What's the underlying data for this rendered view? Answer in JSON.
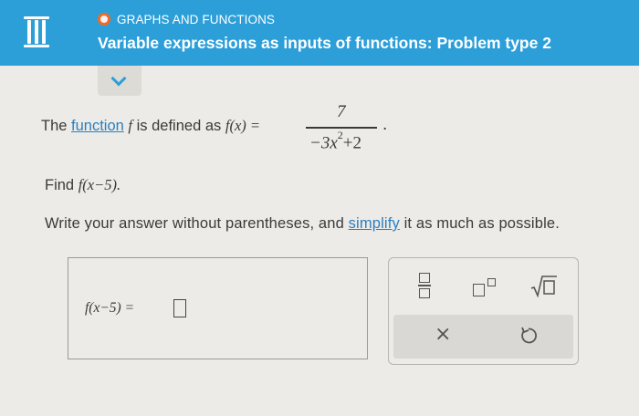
{
  "header": {
    "menu_icon": "hamburger-menu-icon",
    "status_color": "#f36b22",
    "topic": "GRAPHS AND FUNCTIONS",
    "lesson_title": "Variable expressions as inputs of functions: Problem type 2",
    "dropdown_icon": "chevron-down-icon"
  },
  "problem": {
    "intro": "The",
    "function_link": "function",
    "fname": "f",
    "defined_as": "is defined as",
    "lhs": "f(x) =",
    "numerator": "7",
    "denominator_prefix": "−3x",
    "denominator_exp": "2",
    "denominator_suffix": "+2",
    "period": ".",
    "find_label": "Find",
    "find_expr": "f(x−5).",
    "instruction_pre": "Write your answer without parentheses, and",
    "simplify_link": "simplify",
    "instruction_post": "it as much as possible."
  },
  "answer": {
    "label": "f(x−5) =",
    "value": ""
  },
  "keypad": {
    "fraction_icon": "fraction-icon",
    "exponent_icon": "exponent-icon",
    "sqrt_icon": "square-root-icon",
    "clear_label": "×",
    "undo_icon": "undo-icon"
  },
  "colors": {
    "header_bg": "#2c9fd9",
    "link": "#2c7fc0",
    "page_bg": "#ecebe7"
  }
}
